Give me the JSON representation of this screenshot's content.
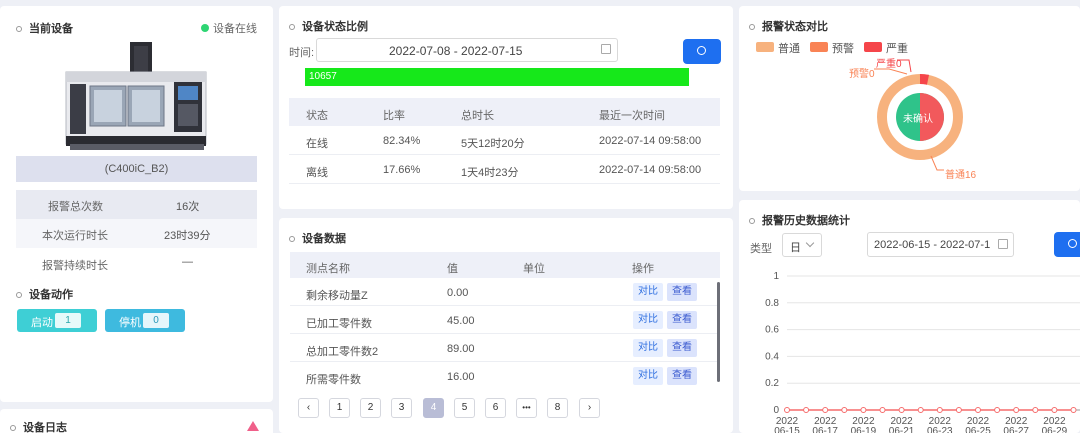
{
  "device": {
    "title": "当前设备",
    "status": "设备在线",
    "status_color": "#2ed573",
    "model": "(C400iC_B2)",
    "info": [
      {
        "label": "报警总次数",
        "value": "16次"
      },
      {
        "label": "本次运行时长",
        "value": "23时39分"
      },
      {
        "label": "报警持续时长",
        "value": "—"
      }
    ],
    "actions_title": "设备动作",
    "actions": [
      {
        "label": "启动",
        "count": "1"
      },
      {
        "label": "停机",
        "count": "0"
      }
    ],
    "log_title": "设备日志"
  },
  "ratio": {
    "title": "设备状态比例",
    "time_label": "时间:",
    "date_range": "2022-07-08 - 2022-07-15",
    "bar_value": "10657",
    "bar_fraction": 1.0,
    "headers": [
      "状态",
      "比率",
      "总时长",
      "最近一次时间"
    ],
    "rows": [
      [
        "在线",
        "82.34%",
        "5天12时20分",
        "2022-07-14 09:58:00"
      ],
      [
        "离线",
        "17.66%",
        "1天4时23分",
        "2022-07-14 09:58:00"
      ]
    ]
  },
  "data": {
    "title": "设备数据",
    "headers": [
      "测点名称",
      "值",
      "单位",
      "操作"
    ],
    "rows": [
      {
        "name": "剩余移动量Z",
        "value": "0.00",
        "unit": ""
      },
      {
        "name": "已加工零件数",
        "value": "45.00",
        "unit": ""
      },
      {
        "name": "总加工零件数2",
        "value": "89.00",
        "unit": ""
      },
      {
        "name": "所需零件数",
        "value": "16.00",
        "unit": ""
      }
    ],
    "op_compare": "对比",
    "op_view": "查看",
    "pages": [
      "1",
      "2",
      "3",
      "4",
      "5",
      "6",
      "•••",
      "8"
    ],
    "current_page": "4"
  },
  "alarm_compare": {
    "title": "报警状态对比",
    "legend": [
      {
        "name": "普通",
        "color": "#f7b27e"
      },
      {
        "name": "预警",
        "color": "#f98355"
      },
      {
        "name": "严重",
        "color": "#f5454a"
      }
    ],
    "center_text": "未确认",
    "labels": [
      "严重0",
      "预警0",
      "普通16"
    ]
  },
  "history": {
    "title": "报警历史数据统计",
    "type_label": "类型",
    "type_value": "日",
    "date_range": "2022-06-15 - 2022-07-1"
  },
  "chart_data": {
    "type": "line",
    "title": "",
    "xlabel": "",
    "ylabel": "",
    "x": [
      "2022 06-15",
      "2022 06-17",
      "2022 06-19",
      "2022 06-21",
      "2022 06-23",
      "2022 06-25",
      "2022 06-27",
      "2022 06-29"
    ],
    "series": [
      {
        "values": [
          0,
          0,
          0,
          0,
          0,
          0,
          0,
          0,
          0,
          0,
          0,
          0,
          0,
          0,
          0,
          0
        ]
      }
    ],
    "yticks": [
      "1",
      "0.8",
      "0.6",
      "0.4",
      "0.2",
      "0"
    ],
    "ylim": [
      0,
      1
    ],
    "line_color": "#f56c6c"
  }
}
